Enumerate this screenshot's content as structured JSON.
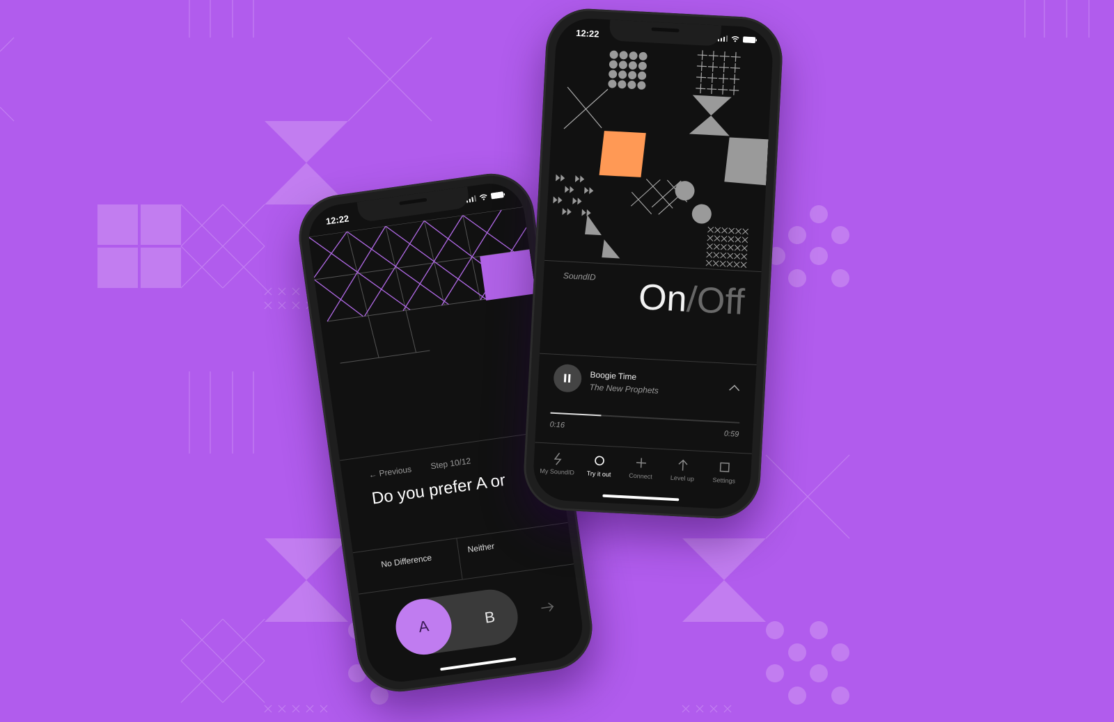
{
  "colors": {
    "background": "#b15ced",
    "accent_purple": "#c07cf0",
    "accent_orange": "#ff9955",
    "screen": "#111111",
    "shape_gray": "#9a9a9a"
  },
  "phone_back": {
    "status": {
      "time": "12:22"
    },
    "nav": {
      "previous_label": "← Previous",
      "step_label": "Step 10/12"
    },
    "question": "Do you prefer A or",
    "options": {
      "no_difference": "No Difference",
      "neither": "Neither"
    },
    "ab_toggle": {
      "a_label": "A",
      "b_label": "B",
      "selected": "A"
    },
    "next_icon": "arrow-right-icon"
  },
  "phone_front": {
    "status": {
      "time": "12:22"
    },
    "soundid": {
      "label": "SoundID",
      "on_label": "On",
      "separator": "/",
      "off_label": "Off"
    },
    "player": {
      "title": "Boogie Time",
      "artist": "The New Prophets",
      "elapsed": "0:16",
      "duration": "0:59",
      "progress_fraction": 0.27,
      "state": "playing"
    },
    "tabbar": [
      {
        "label": "My SoundID",
        "icon": "lightning-icon",
        "active": false
      },
      {
        "label": "Try it out",
        "icon": "circle-icon",
        "active": true
      },
      {
        "label": "Connect",
        "icon": "plus-icon",
        "active": false
      },
      {
        "label": "Level up",
        "icon": "arrow-up-icon",
        "active": false
      },
      {
        "label": "Settings",
        "icon": "square-icon",
        "active": false
      }
    ]
  }
}
